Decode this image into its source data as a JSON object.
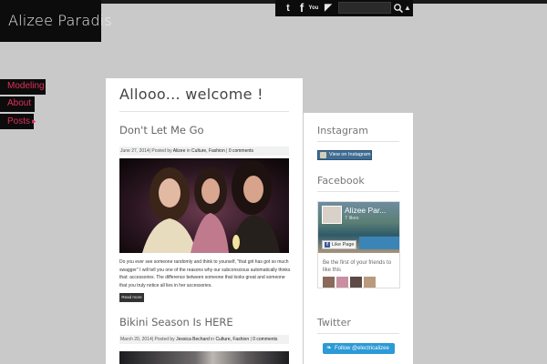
{
  "site": {
    "title": "Alizee Paradis"
  },
  "nav": [
    {
      "label": "Modeling"
    },
    {
      "label": "About"
    },
    {
      "label": "Posts"
    }
  ],
  "social": {
    "icons": [
      "twitter-icon",
      "facebook-icon",
      "youtube-icon",
      "rss-icon"
    ],
    "twitter_glyph": "t",
    "facebook_glyph": "f",
    "youtube_glyph": "You",
    "rss_glyph": "◤",
    "caret_glyph": "▲"
  },
  "main": {
    "heading": "Allooo... welcome !",
    "posts": [
      {
        "title": "Don't Let Me Go",
        "date": "June 27, 2014",
        "posted_by_prefix": "| Posted by ",
        "author": "Alizee",
        "in_word": " in ",
        "categories": "Culture, Fashion",
        "comments_sep": " | ",
        "comments": "0 comments",
        "excerpt": "Do you ever see someone randomly and think to yourself, \"that girl has got so much swagger\" I will tell you one of the reasons why our subconscious automatically thinks that: accessories. The difference between someone that looks great and someone that you truly notice all lies in her accessories.",
        "read_more": "Read more"
      },
      {
        "title": "Bikini Season Is HERE",
        "date": "March 20, 2014",
        "posted_by_prefix": "| Posted by ",
        "author": "Jessica Bechard",
        "in_word": " in ",
        "categories": "Culture, Fashion",
        "comments_sep": " | ",
        "comments": "0 comments"
      }
    ]
  },
  "sidebar": {
    "instagram": {
      "title": "Instagram",
      "button": "View on Instagram"
    },
    "facebook": {
      "title": "Facebook",
      "page_name": "Alizee Par...",
      "likes": "7 likes",
      "like_button": "Like Page",
      "friends_text": "Be the first of your friends to like this"
    },
    "twitter": {
      "title": "Twitter",
      "button": "Follow @electricalizee",
      "bird_glyph": "❧"
    }
  },
  "colors": {
    "background": "#c9c9c9",
    "nav_text": "#e0305a",
    "twitter_button": "#2b9ad6",
    "instagram_button": "#3f6d94"
  }
}
